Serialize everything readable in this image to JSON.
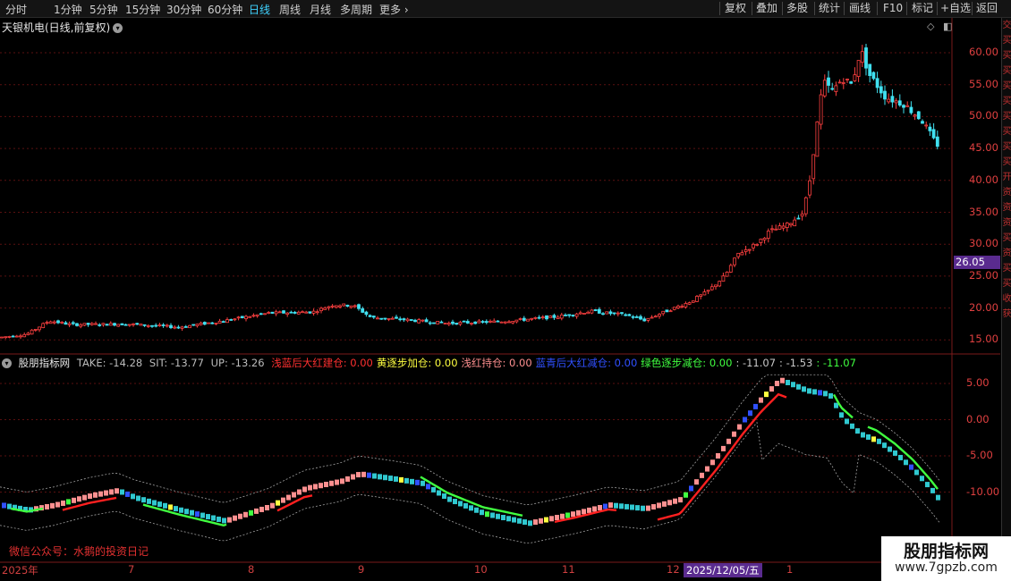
{
  "menu": {
    "periods": [
      "分时",
      "1分钟",
      "5分钟",
      "15分钟",
      "30分钟",
      "60分钟",
      "日线",
      "周线",
      "月线",
      "多周期",
      "更多"
    ],
    "active": "日线",
    "right_buttons": [
      "复权",
      "叠加",
      "多股",
      "统计",
      "画线",
      "F10",
      "标记",
      "+自选",
      "返回"
    ]
  },
  "stock": {
    "title": "天银机电(日线,前复权)"
  },
  "price_axis": {
    "labels": [
      "60.00",
      "55.00",
      "50.00",
      "45.00",
      "40.00",
      "35.00",
      "30.00",
      "25.00",
      "20.00",
      "15.00"
    ],
    "current": "26.05"
  },
  "indicator": {
    "name": "股朋指标网",
    "take": "TAKE: -14.28",
    "sit": "SIT: -13.77",
    "up": "UP: -13.26",
    "items": [
      {
        "label": "浅蓝后大红建仓: 0.00",
        "color": "#ff3030"
      },
      {
        "label": "黄逐步加仓: 0.00",
        "color": "#ffff40"
      },
      {
        "label": "浅红持仓: 0.00",
        "color": "#ff9090"
      },
      {
        "label": "蓝青后大红减仓: 0.00",
        "color": "#3050ff"
      },
      {
        "label": "绿色逐步减仓: 0.00",
        "color": "#40ff40"
      },
      {
        "label": ": -11.07",
        "color": "#c8c8c8"
      },
      {
        "label": ": -1.53",
        "color": "#c8c8c8"
      },
      {
        "label": ": -11.07",
        "color": "#40ff40"
      }
    ],
    "axis_labels": [
      "5.00",
      "0.00",
      "-5.00",
      "-10.00"
    ]
  },
  "date_axis": {
    "labels": [
      "2025年",
      "7",
      "8",
      "9",
      "10",
      "11",
      "12",
      "1"
    ],
    "current": "2025/12/05/五"
  },
  "footer": {
    "note": "微信公众号：水鹅的投资日记"
  },
  "watermark": {
    "title": "股朋指标网",
    "url": "www.7gpzb.com"
  },
  "sidebar": {
    "chars": [
      "交",
      "买",
      "买",
      "买",
      "买",
      "买",
      "买",
      "买",
      "买",
      "买",
      "开",
      "资",
      "资",
      "资",
      "买",
      "资",
      "买",
      "买",
      "收",
      "获"
    ]
  },
  "colors": {
    "up": "#ff4040",
    "down": "#40e0f0",
    "grid": "#5a1010",
    "purple": "#5a2b8f"
  }
}
